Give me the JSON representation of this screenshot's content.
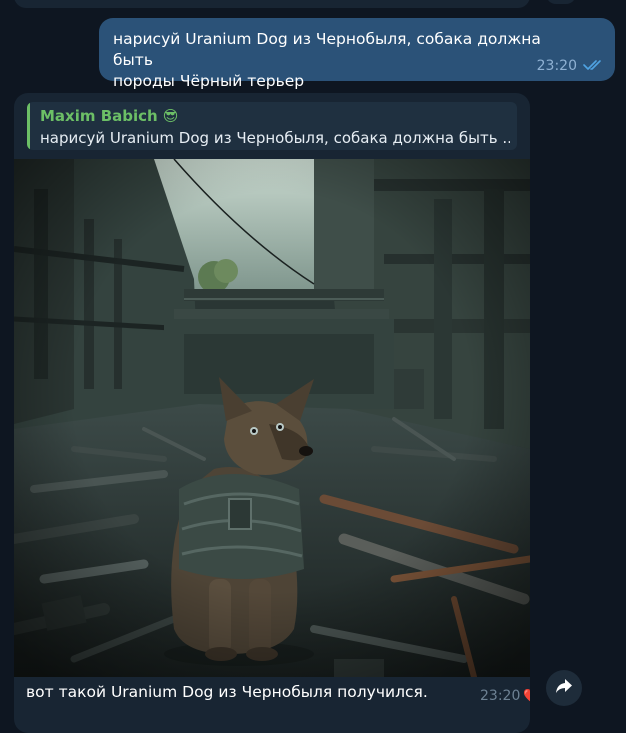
{
  "outgoing": {
    "text_line1": "нарисуй Uranium Dog из Чернобыля, собака должна быть",
    "text_line2": "породы Чёрный терьер",
    "time": "23:20",
    "status_icon": "double-check-read-icon"
  },
  "incoming": {
    "reply": {
      "author": "Maxim Babich",
      "author_emoji": "😎",
      "text": "нарисуй Uranium Dog из Чернобыля, собака должна быть ..."
    },
    "image": {
      "subject": "dog-in-ruined-industrial-hall"
    },
    "caption": "вот такой Uranium Dog из Чернобыля получился.",
    "time": "23:20",
    "reaction": "❤️"
  },
  "colors": {
    "background": "#0e1621",
    "outgoing_bubble": "#2b5278",
    "incoming_bubble": "#182533",
    "reply_accent": "#6cbf66",
    "read_check": "#4fa3e3"
  },
  "actions": {
    "forward_icon": "share-arrow-icon"
  }
}
